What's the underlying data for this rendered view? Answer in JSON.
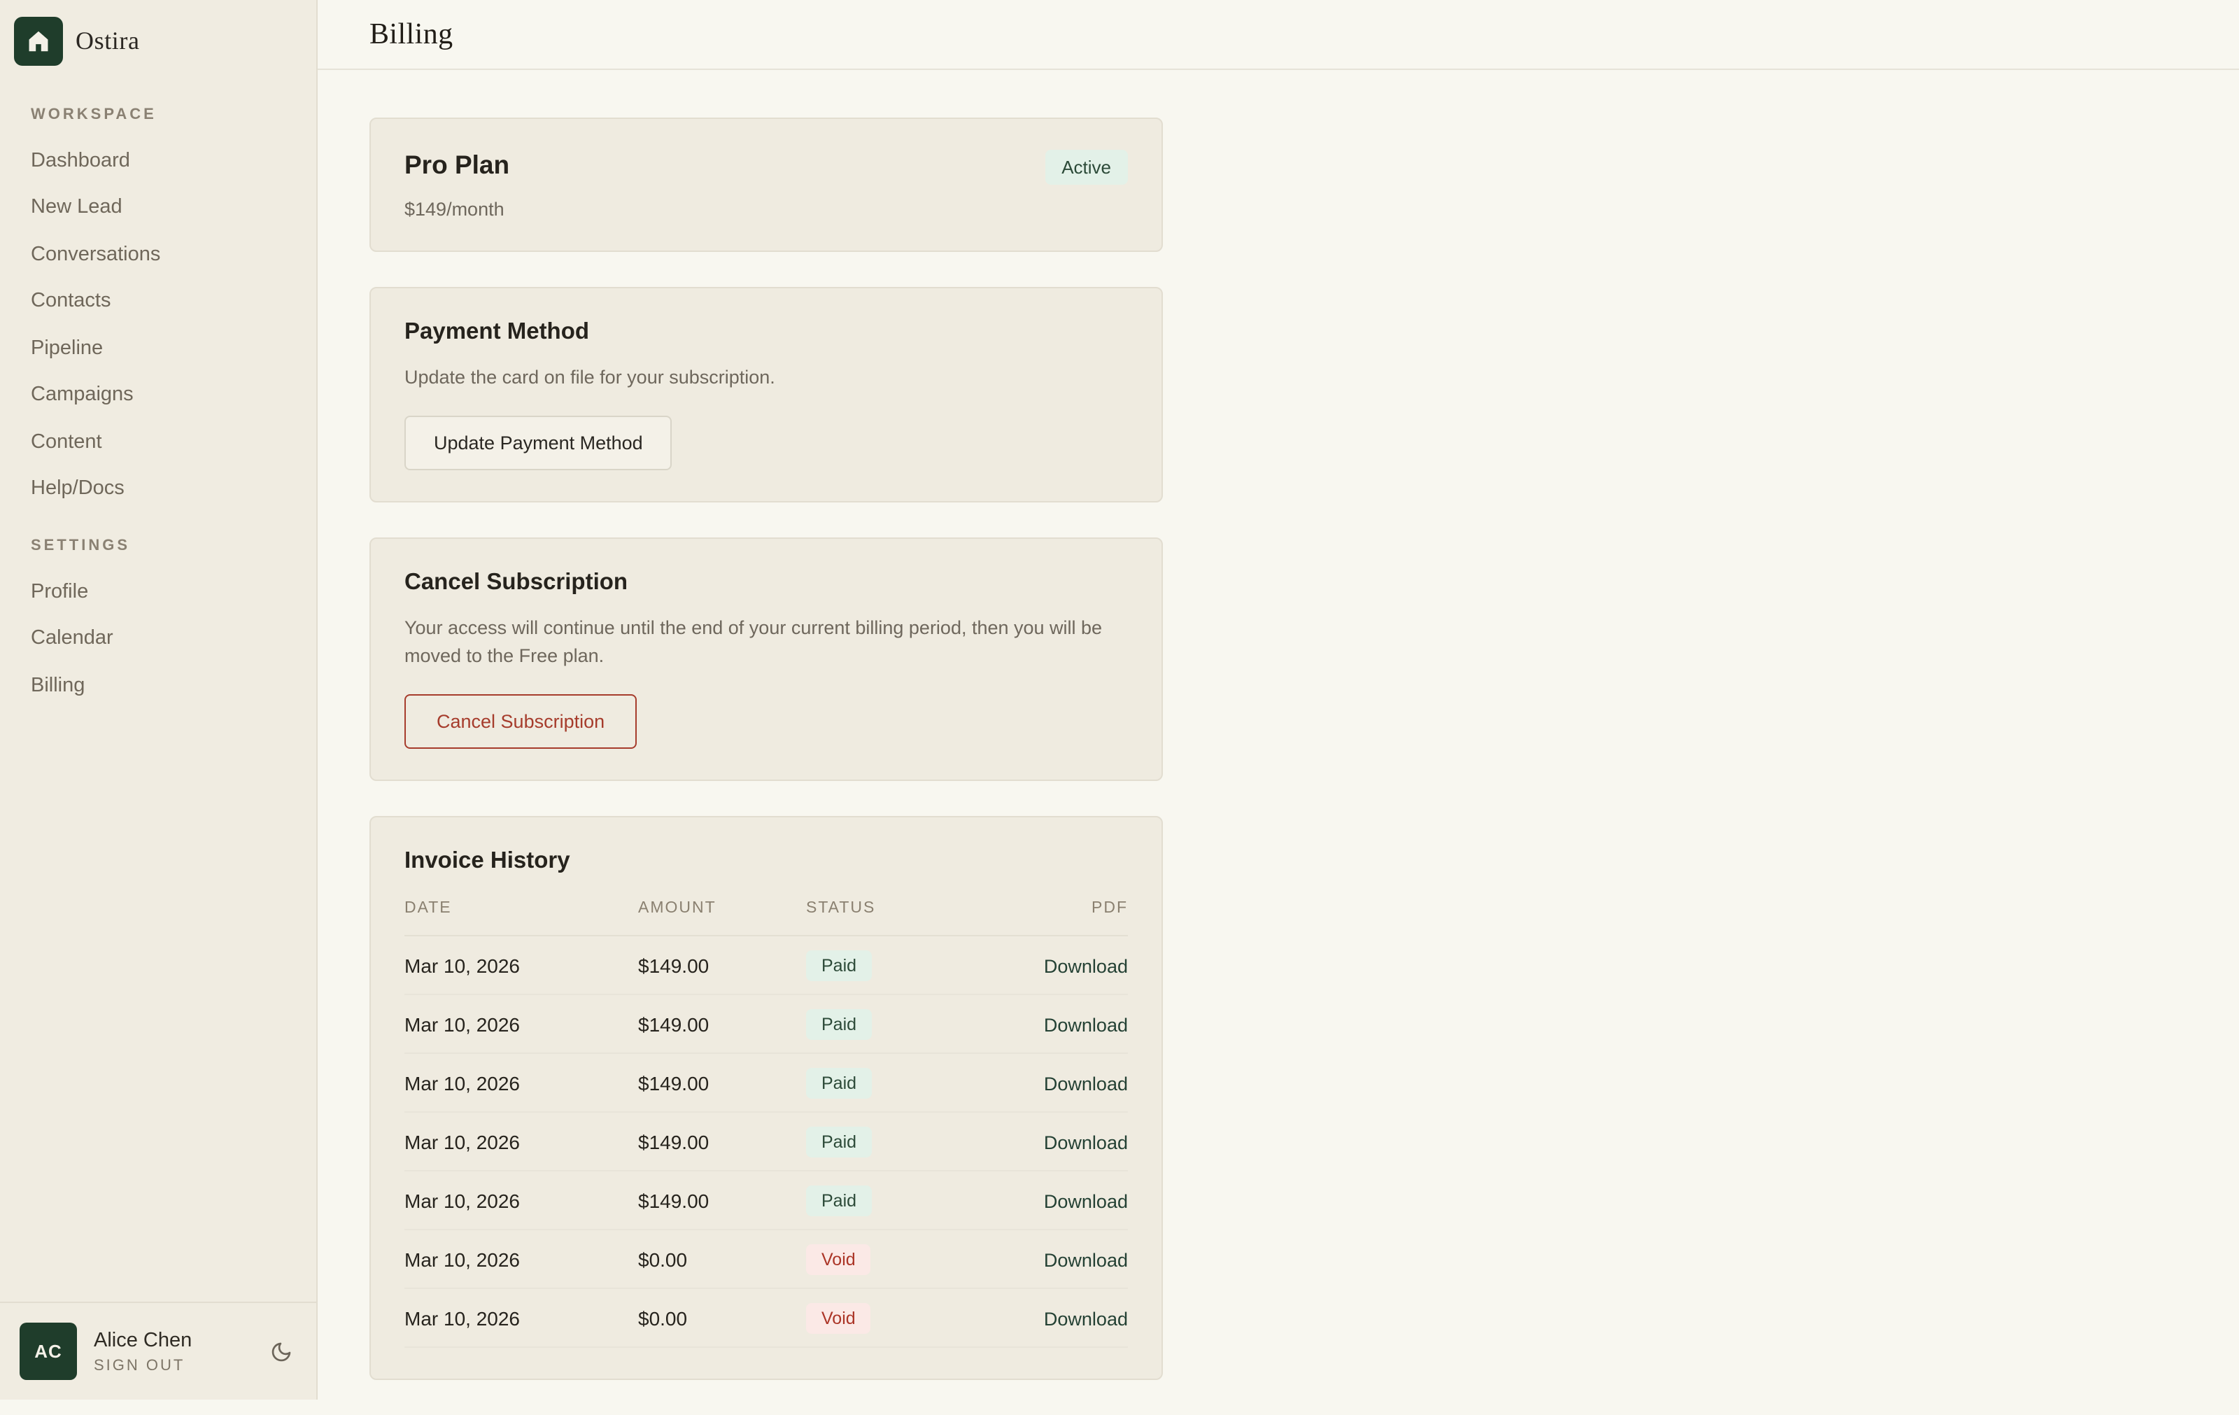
{
  "brand": {
    "name": "Ostira"
  },
  "sidebar": {
    "sections": [
      {
        "label": "WORKSPACE",
        "items": [
          "Dashboard",
          "New Lead",
          "Conversations",
          "Contacts",
          "Pipeline",
          "Campaigns",
          "Content",
          "Help/Docs"
        ]
      },
      {
        "label": "SETTINGS",
        "items": [
          "Profile",
          "Calendar",
          "Billing"
        ]
      }
    ],
    "user": {
      "initials": "AC",
      "name": "Alice Chen",
      "signout_label": "SIGN OUT"
    }
  },
  "header": {
    "title": "Billing"
  },
  "plan_card": {
    "title": "Pro Plan",
    "price": "$149/month",
    "badge": "Active"
  },
  "payment_card": {
    "title": "Payment Method",
    "description": "Update the card on file for your subscription.",
    "button_label": "Update Payment Method"
  },
  "cancel_card": {
    "title": "Cancel Subscription",
    "description": "Your access will continue until the end of your current billing period, then you will be moved to the Free plan.",
    "button_label": "Cancel Subscription"
  },
  "invoices": {
    "title": "Invoice History",
    "columns": [
      "DATE",
      "AMOUNT",
      "STATUS",
      "PDF"
    ],
    "download_label": "Download",
    "rows": [
      {
        "date": "Mar 10, 2026",
        "amount": "$149.00",
        "status": "Paid"
      },
      {
        "date": "Mar 10, 2026",
        "amount": "$149.00",
        "status": "Paid"
      },
      {
        "date": "Mar 10, 2026",
        "amount": "$149.00",
        "status": "Paid"
      },
      {
        "date": "Mar 10, 2026",
        "amount": "$149.00",
        "status": "Paid"
      },
      {
        "date": "Mar 10, 2026",
        "amount": "$149.00",
        "status": "Paid"
      },
      {
        "date": "Mar 10, 2026",
        "amount": "$0.00",
        "status": "Void"
      },
      {
        "date": "Mar 10, 2026",
        "amount": "$0.00",
        "status": "Void"
      }
    ]
  },
  "colors": {
    "accent_green": "#1f3d2b",
    "badge_green_bg": "#e3f1e8",
    "badge_green_text": "#2c4a38",
    "link_green": "#244134",
    "danger_red": "#a63c2c",
    "void_bg": "#fbe9e6",
    "void_text": "#ab3527",
    "sidebar_bg": "#f0ece1",
    "main_bg": "#f8f7f0",
    "card_bg": "#efebe0",
    "border": "#e2ddd0"
  }
}
